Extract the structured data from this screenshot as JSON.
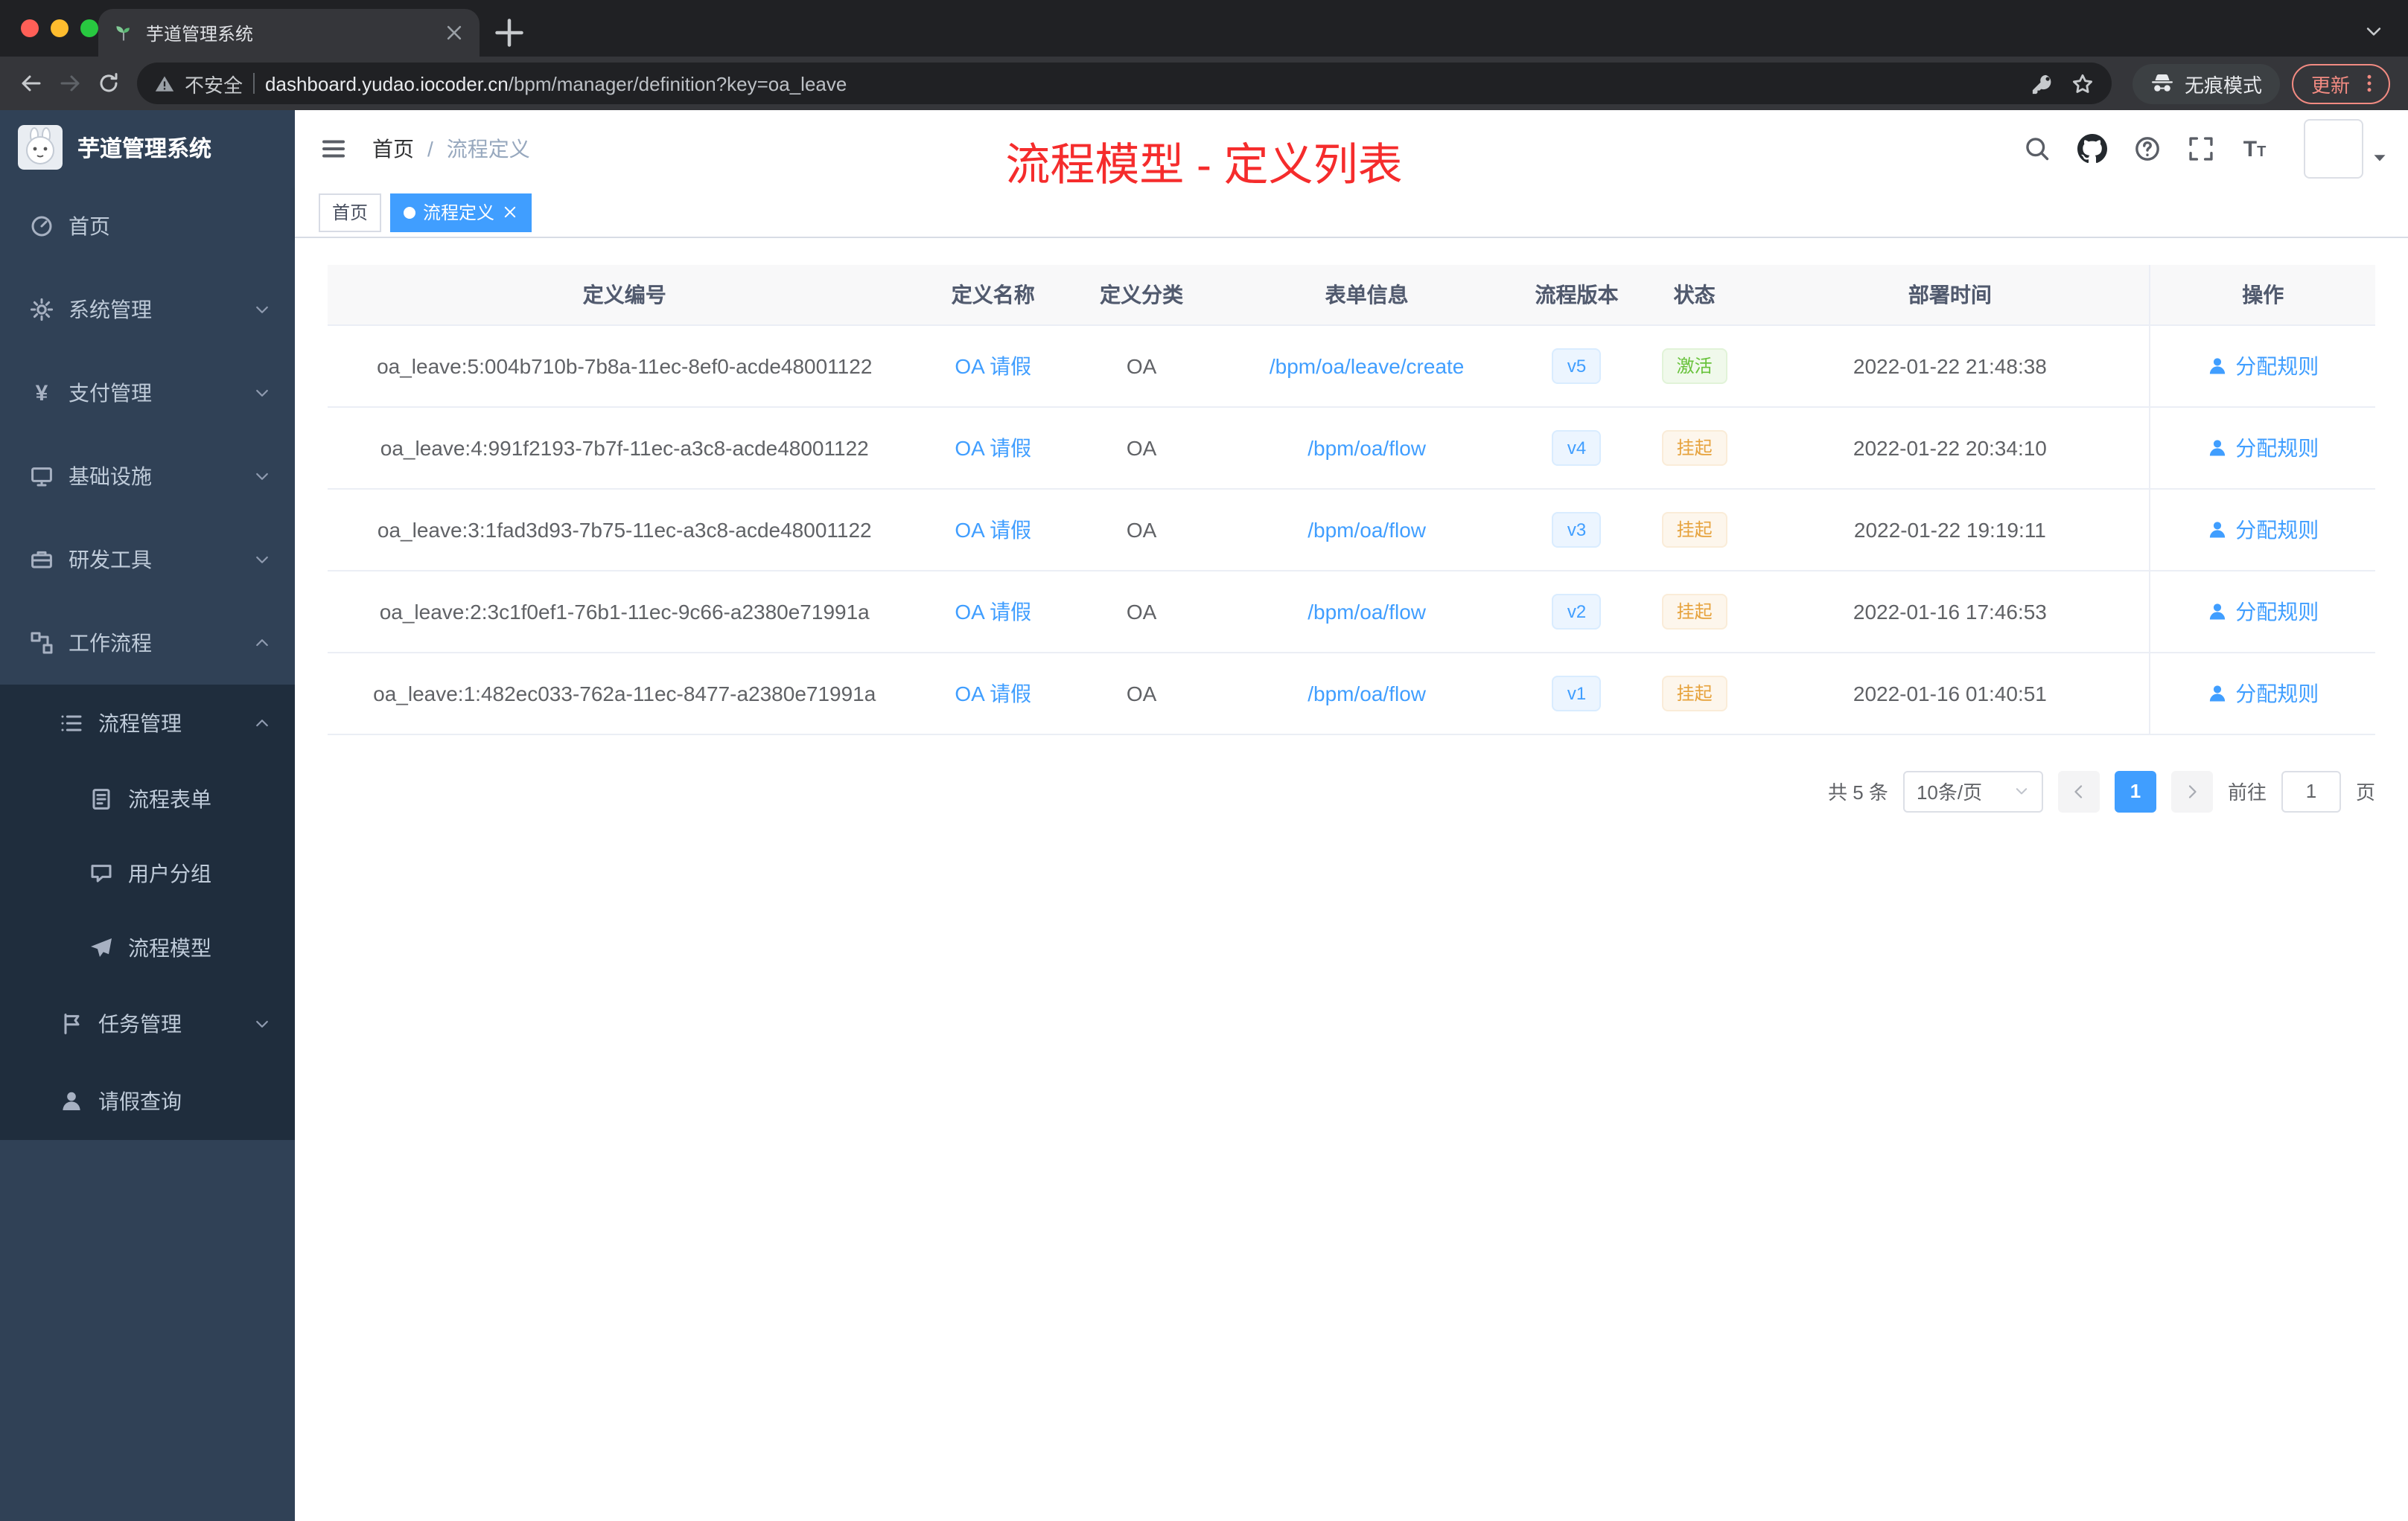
{
  "browser": {
    "tab": {
      "title": "芋道管理系统"
    },
    "toolbar": {
      "security_label": "不安全",
      "url_domain": "dashboard.yudao.iocoder.cn",
      "url_path": "/bpm/manager/definition?key=oa_leave",
      "incognito_label": "无痕模式",
      "update_label": "更新"
    }
  },
  "sidebar": {
    "logo_title": "芋道管理系统",
    "items": [
      {
        "key": "home",
        "label": "首页",
        "icon": "dashboard-icon",
        "level": 1
      },
      {
        "key": "system-management",
        "label": "系统管理",
        "icon": "gear-icon",
        "level": 1,
        "arrow": "down"
      },
      {
        "key": "payment-management",
        "label": "支付管理",
        "icon": "yen-icon",
        "level": 1,
        "arrow": "down"
      },
      {
        "key": "infrastructure",
        "label": "基础设施",
        "icon": "infra-icon",
        "level": 1,
        "arrow": "down"
      },
      {
        "key": "dev-tools",
        "label": "研发工具",
        "icon": "toolbox-icon",
        "level": 1,
        "arrow": "down"
      },
      {
        "key": "workflow",
        "label": "工作流程",
        "icon": "workflow-icon",
        "level": 1,
        "arrow": "up"
      },
      {
        "key": "process-management",
        "label": "流程管理",
        "icon": "list-icon",
        "level": 2,
        "arrow": "up",
        "sub": true
      },
      {
        "key": "process-form",
        "label": "流程表单",
        "icon": "form-icon",
        "level": 3,
        "sub": true
      },
      {
        "key": "user-group",
        "label": "用户分组",
        "icon": "user-group-icon",
        "level": 3,
        "sub": true
      },
      {
        "key": "process-model",
        "label": "流程模型",
        "icon": "paper-plane-icon",
        "level": 3,
        "sub": true
      },
      {
        "key": "task-management",
        "label": "任务管理",
        "icon": "task-icon",
        "level": 2,
        "arrow": "down",
        "sub": true
      },
      {
        "key": "leave-query",
        "label": "请假查询",
        "icon": "user-icon",
        "level": 2,
        "sub": true
      }
    ]
  },
  "navbar": {
    "breadcrumb": [
      "首页",
      "流程定义"
    ],
    "right_icons": [
      "search-icon",
      "github-icon",
      "question-icon",
      "fullscreen-icon",
      "font-size-icon"
    ],
    "page_title_overlay": "流程模型 - 定义列表"
  },
  "tags_view": {
    "tags": [
      {
        "key": "home",
        "label": "首页",
        "active": false,
        "closable": false
      },
      {
        "key": "process-definition",
        "label": "流程定义",
        "active": true,
        "closable": true
      }
    ]
  },
  "table": {
    "columns": [
      "定义编号",
      "定义名称",
      "定义分类",
      "表单信息",
      "流程版本",
      "状态",
      "部署时间",
      "操作"
    ],
    "action_label": "分配规则",
    "rows": [
      {
        "id": "oa_leave:5:004b710b-7b8a-11ec-8ef0-acde48001122",
        "name": "OA 请假",
        "category": "OA",
        "form": "/bpm/oa/leave/create",
        "version": "v5",
        "status": "激活",
        "status_type": "success",
        "deploy_time": "2022-01-22 21:48:38"
      },
      {
        "id": "oa_leave:4:991f2193-7b7f-11ec-a3c8-acde48001122",
        "name": "OA 请假",
        "category": "OA",
        "form": "/bpm/oa/flow",
        "version": "v4",
        "status": "挂起",
        "status_type": "warning",
        "deploy_time": "2022-01-22 20:34:10"
      },
      {
        "id": "oa_leave:3:1fad3d93-7b75-11ec-a3c8-acde48001122",
        "name": "OA 请假",
        "category": "OA",
        "form": "/bpm/oa/flow",
        "version": "v3",
        "status": "挂起",
        "status_type": "warning",
        "deploy_time": "2022-01-22 19:19:11"
      },
      {
        "id": "oa_leave:2:3c1f0ef1-76b1-11ec-9c66-a2380e71991a",
        "name": "OA 请假",
        "category": "OA",
        "form": "/bpm/oa/flow",
        "version": "v2",
        "status": "挂起",
        "status_type": "warning",
        "deploy_time": "2022-01-16 17:46:53"
      },
      {
        "id": "oa_leave:1:482ec033-762a-11ec-8477-a2380e71991a",
        "name": "OA 请假",
        "category": "OA",
        "form": "/bpm/oa/flow",
        "version": "v1",
        "status": "挂起",
        "status_type": "warning",
        "deploy_time": "2022-01-16 01:40:51"
      }
    ]
  },
  "pagination": {
    "total_label": "共 5 条",
    "page_size_label": "10条/页",
    "current_page": "1",
    "goto_label": "前往",
    "goto_value": "1",
    "page_unit_label": "页"
  },
  "colors": {
    "accent_blue": "#409eff",
    "success_green": "#67c23a",
    "warning_orange": "#e6a23c",
    "title_red": "#f52c2c",
    "sidebar_bg": "#304156",
    "submenu_bg": "#1f2d3d"
  }
}
